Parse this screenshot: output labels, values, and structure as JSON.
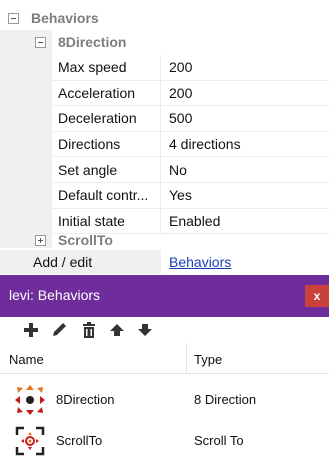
{
  "properties": {
    "section_title": "Behaviors",
    "behavior_title": "8Direction",
    "rows": [
      {
        "key": "Max speed",
        "value": "200"
      },
      {
        "key": "Acceleration",
        "value": "200"
      },
      {
        "key": "Deceleration",
        "value": "500"
      },
      {
        "key": "Directions",
        "value": "4 directions"
      },
      {
        "key": "Set angle",
        "value": "No"
      },
      {
        "key": "Default contr...",
        "value": "Yes"
      },
      {
        "key": "Initial state",
        "value": "Enabled"
      }
    ],
    "collapsed_behavior": "ScrollTo",
    "add_edit_label": "Add / edit",
    "add_edit_link": "Behaviors"
  },
  "dialog": {
    "title": "levi: Behaviors",
    "close_label": "x",
    "toolbar_icons": [
      "add-icon",
      "edit-pencil-icon",
      "delete-trash-icon",
      "move-up-icon",
      "move-down-icon"
    ],
    "columns": {
      "name": "Name",
      "type": "Type"
    },
    "items": [
      {
        "name": "8Direction",
        "type": "8 Direction",
        "icon": "8direction-icon"
      },
      {
        "name": "ScrollTo",
        "type": "Scroll To",
        "icon": "scrollto-icon"
      }
    ]
  },
  "colors": {
    "titlebar": "#6e2d9a",
    "close_button": "#c8413a",
    "link": "#1a3fb8",
    "icon_orange": "#e8731f",
    "icon_red": "#c81a1a"
  }
}
